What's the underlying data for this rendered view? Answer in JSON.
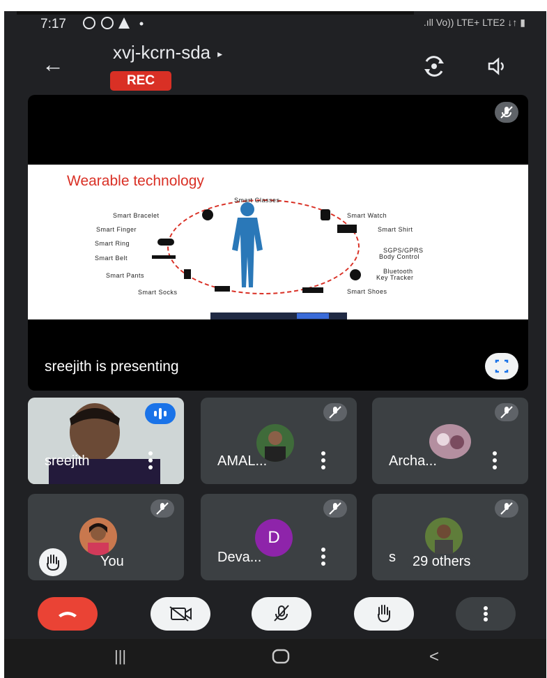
{
  "status_bar": {
    "time": "7:17",
    "network": "Vo)) LTE+ LTE2 ↓↑",
    "signal_text": ".ıll"
  },
  "header": {
    "meeting_code": "xvj-kcrn-sda",
    "caret": "▸",
    "rec_badge": "REC",
    "back_glyph": "←"
  },
  "stage": {
    "slide_title": "Wearable technology",
    "labels": {
      "smart_glasses": "Smart Glasses",
      "smart_bracelet": "Smart Bracelet",
      "smart_finger": "Smart Finger",
      "smart_ring": "Smart Ring",
      "smart_belt": "Smart Belt",
      "smart_pants": "Smart Pants",
      "smart_socks": "Smart Socks",
      "smart_watch": "Smart Watch",
      "smart_shirt": "Smart Shirt",
      "gps": "SGPS/GPRS",
      "body_control": "Body Control",
      "bluetooth": "Bluetooth",
      "key_tracker": "Key Tracker",
      "smart_shoes": "Smart Shoes"
    },
    "presenting_text": "sreejith is presenting"
  },
  "participants": [
    {
      "name": "sreejith",
      "kind": "video"
    },
    {
      "name": "AMAL...",
      "kind": "photo"
    },
    {
      "name": "Archa...",
      "kind": "photo"
    },
    {
      "name": "You",
      "kind": "photo"
    },
    {
      "name": "Deva...",
      "kind": "initial",
      "initial": "D",
      "color": "#8e24aa"
    },
    {
      "name": "s",
      "kind": "photo"
    }
  ],
  "others_count": "29 others",
  "colors": {
    "background": "#202124",
    "tile": "#3c4043",
    "rec": "#d93025",
    "hangup": "#ea4335",
    "speaking": "#1a73e8"
  }
}
